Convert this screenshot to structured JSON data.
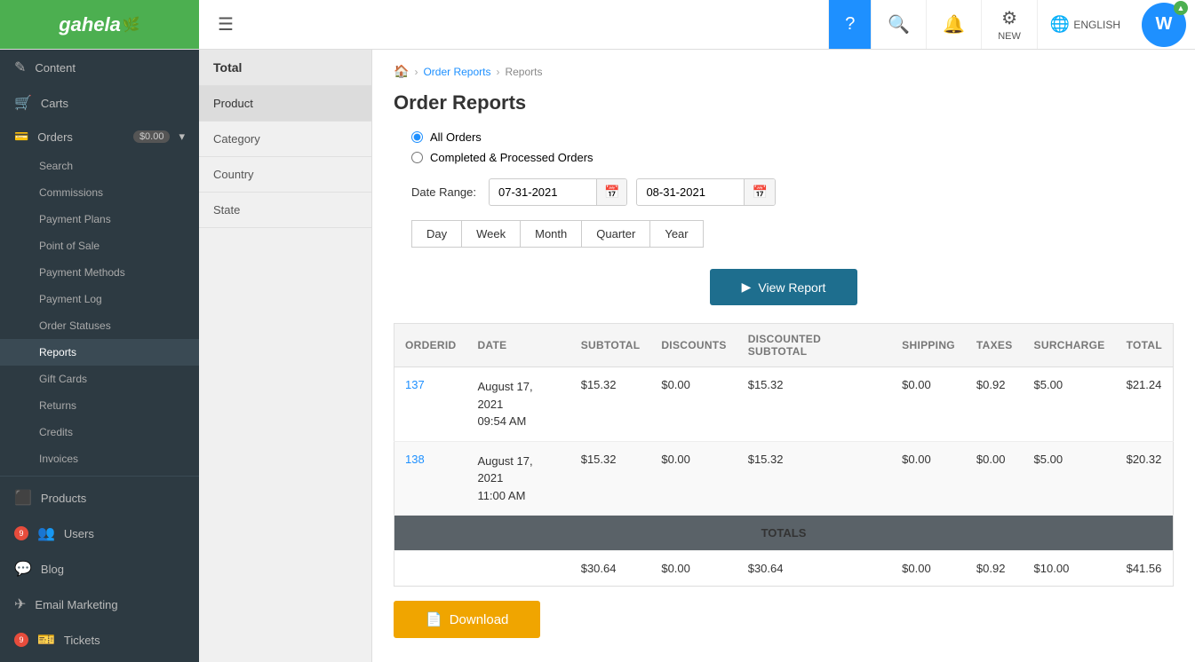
{
  "header": {
    "logo_text": "gahela",
    "help_label": "",
    "new_label": "NEW",
    "lang_label": "ENGLISH",
    "avatar_letter": "W",
    "avatar_badge": "↑"
  },
  "sidebar": {
    "items": [
      {
        "id": "content",
        "label": "Content",
        "icon": "✎"
      },
      {
        "id": "carts",
        "label": "Carts",
        "icon": "🛒"
      },
      {
        "id": "orders",
        "label": "Orders",
        "badge": "$0.00",
        "icon": "💳",
        "arrow": "▾",
        "active": true
      },
      {
        "id": "products",
        "label": "Products",
        "icon": "⬛"
      },
      {
        "id": "users",
        "label": "Users",
        "icon": "👥",
        "badge_num": "9"
      },
      {
        "id": "blog",
        "label": "Blog",
        "icon": "💬"
      },
      {
        "id": "email_marketing",
        "label": "Email Marketing",
        "icon": "✈"
      },
      {
        "id": "tickets",
        "label": "Tickets",
        "icon": "🎫",
        "badge_num": "9"
      }
    ],
    "orders_sub": [
      {
        "id": "search",
        "label": "Search"
      },
      {
        "id": "commissions",
        "label": "Commissions"
      },
      {
        "id": "payment_plans",
        "label": "Payment Plans"
      },
      {
        "id": "point_of_sale",
        "label": "Point of Sale"
      },
      {
        "id": "payment_methods",
        "label": "Payment Methods"
      },
      {
        "id": "payment_log",
        "label": "Payment Log"
      },
      {
        "id": "order_statuses",
        "label": "Order Statuses"
      },
      {
        "id": "reports",
        "label": "Reports",
        "active": true
      },
      {
        "id": "gift_cards",
        "label": "Gift Cards"
      },
      {
        "id": "returns",
        "label": "Returns"
      },
      {
        "id": "credits",
        "label": "Credits"
      },
      {
        "id": "invoices",
        "label": "Invoices"
      }
    ]
  },
  "sub_sidebar": {
    "header": "Total",
    "items": [
      {
        "id": "product",
        "label": "Product",
        "active": false
      },
      {
        "id": "category",
        "label": "Category",
        "active": false
      },
      {
        "id": "country",
        "label": "Country",
        "active": false
      },
      {
        "id": "state",
        "label": "State",
        "active": false
      }
    ]
  },
  "main": {
    "breadcrumb": {
      "home_icon": "🏠",
      "order_reports": "Order Reports",
      "reports": "Reports"
    },
    "title": "Order Reports",
    "radio_options": [
      {
        "id": "all_orders",
        "label": "All Orders",
        "checked": true
      },
      {
        "id": "completed",
        "label": "Completed & Processed Orders",
        "checked": false
      }
    ],
    "date_range": {
      "label": "Date Range:",
      "start": "07-31-2021",
      "end": "08-31-2021"
    },
    "period_buttons": [
      {
        "id": "day",
        "label": "Day"
      },
      {
        "id": "week",
        "label": "Week"
      },
      {
        "id": "month",
        "label": "Month"
      },
      {
        "id": "quarter",
        "label": "Quarter"
      },
      {
        "id": "year",
        "label": "Year"
      }
    ],
    "view_report_btn": "View Report",
    "table": {
      "headers": [
        "ORDERID",
        "DATE",
        "SUBTOTAL",
        "DISCOUNTS",
        "DISCOUNTED SUBTOTAL",
        "SHIPPING",
        "TAXES",
        "SURCHARGE",
        "TOTAL"
      ],
      "rows": [
        {
          "order_id": "137",
          "date_line1": "August 17, 2021",
          "date_line2": "09:54 AM",
          "subtotal": "$15.32",
          "discounts": "$0.00",
          "discounted_subtotal": "$15.32",
          "shipping": "$0.00",
          "taxes": "$0.92",
          "surcharge": "$5.00",
          "total": "$21.24"
        },
        {
          "order_id": "138",
          "date_line1": "August 17, 2021",
          "date_line2": "11:00 AM",
          "subtotal": "$15.32",
          "discounts": "$0.00",
          "discounted_subtotal": "$15.32",
          "shipping": "$0.00",
          "taxes": "$0.00",
          "surcharge": "$5.00",
          "total": "$20.32"
        }
      ],
      "totals_label": "TOTALS",
      "totals_row": {
        "subtotal": "$30.64",
        "discounts": "$0.00",
        "discounted_subtotal": "$30.64",
        "shipping": "$0.00",
        "taxes": "$0.92",
        "surcharge": "$10.00",
        "total": "$41.56"
      }
    },
    "download_btn": "Download"
  }
}
